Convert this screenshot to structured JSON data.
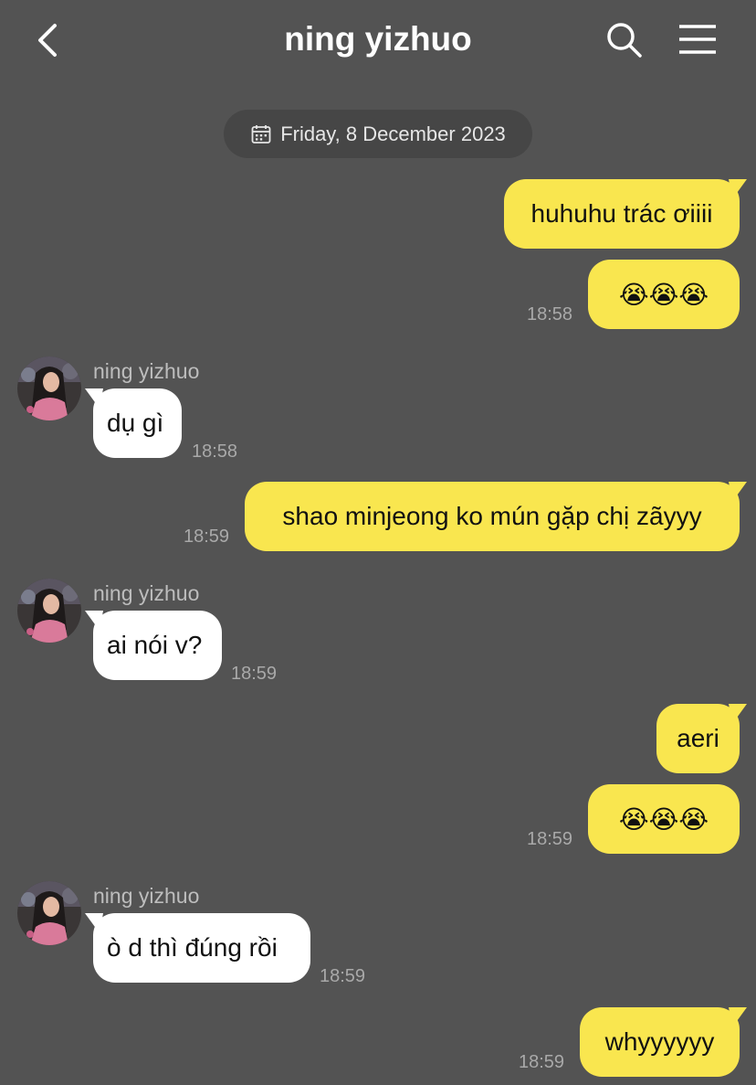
{
  "header": {
    "title": "ning yizhuo",
    "back_icon": "chevron-left-icon",
    "search_icon": "search-icon",
    "menu_icon": "hamburger-menu-icon"
  },
  "date_divider": "Friday, 8 December 2023",
  "colors": {
    "background": "#535353",
    "my_bubble": "#f9e64f",
    "their_bubble": "#ffffff",
    "timestamp": "#a9a9a9"
  },
  "messages": [
    {
      "from": "me",
      "text": "huhuhu trác ơiiii"
    },
    {
      "from": "me",
      "text": "😭😭😭",
      "time": "18:58"
    },
    {
      "from": "them",
      "sender": "ning yizhuo",
      "text": "dụ gì",
      "time": "18:58"
    },
    {
      "from": "me",
      "text": "shao minjeong ko mún gặp chị zãyyy",
      "time": "18:59"
    },
    {
      "from": "them",
      "sender": "ning yizhuo",
      "text": "ai nói v?",
      "time": "18:59"
    },
    {
      "from": "me",
      "text": "aeri"
    },
    {
      "from": "me",
      "text": "😭😭😭",
      "time": "18:59"
    },
    {
      "from": "them",
      "sender": "ning yizhuo",
      "text": "ò d thì đúng rồi",
      "time": "18:59"
    },
    {
      "from": "me",
      "text": "whyyyyyy",
      "time": "18:59"
    }
  ]
}
